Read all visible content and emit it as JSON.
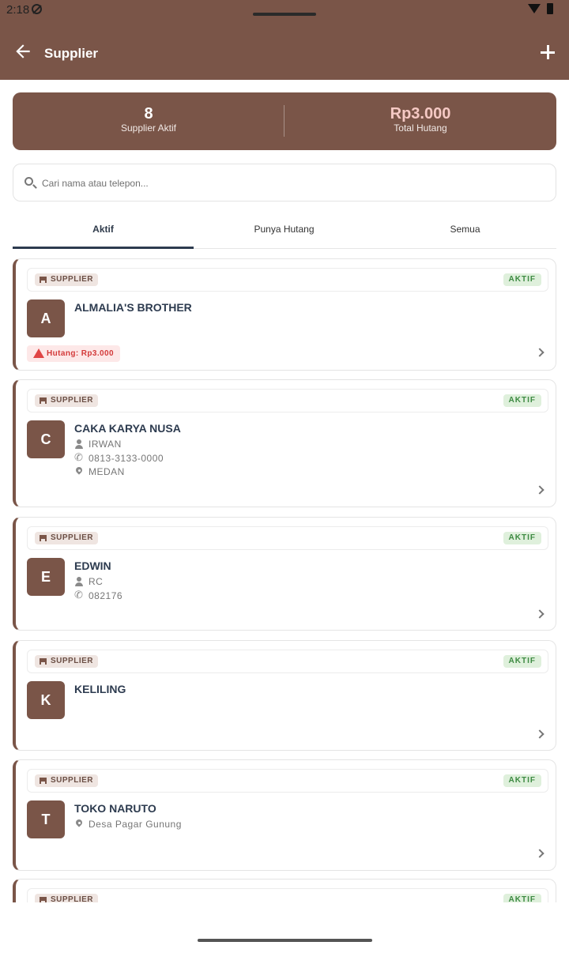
{
  "status": {
    "time": "2:18"
  },
  "app_bar": {
    "title": "Supplier"
  },
  "summary": {
    "active_count": "8",
    "active_label": "Supplier Aktif",
    "debt_total": "Rp3.000",
    "debt_label": "Total Hutang"
  },
  "search": {
    "placeholder": "Cari nama atau telepon..."
  },
  "tabs": [
    {
      "label": "Aktif",
      "active": true
    },
    {
      "label": "Punya Hutang",
      "active": false
    },
    {
      "label": "Semua",
      "active": false
    }
  ],
  "suppliers": [
    {
      "type": "SUPPLIER",
      "status": "AKTIF",
      "initial": "A",
      "name": "ALMALIA'S BROTHER",
      "debt": "Hutang: Rp3.000"
    },
    {
      "type": "SUPPLIER",
      "status": "AKTIF",
      "initial": "C",
      "name": "CAKA KARYA NUSA",
      "contact": "IRWAN",
      "phone": "0813-3133-0000",
      "address": "MEDAN"
    },
    {
      "type": "SUPPLIER",
      "status": "AKTIF",
      "initial": "E",
      "name": "EDWIN",
      "contact": "RC",
      "phone": "082176"
    },
    {
      "type": "SUPPLIER",
      "status": "AKTIF",
      "initial": "K",
      "name": "KELILING"
    },
    {
      "type": "SUPPLIER",
      "status": "AKTIF",
      "initial": "T",
      "name": "TOKO NARUTO",
      "address": "Desa Pagar Gunung"
    },
    {
      "type": "SUPPLIER",
      "status": "AKTIF"
    }
  ],
  "colors": {
    "primary": "#7a5548",
    "active_badge": "#3d8a42",
    "debt": "#d33a3a",
    "tab_indicator": "#2d3b4f"
  }
}
